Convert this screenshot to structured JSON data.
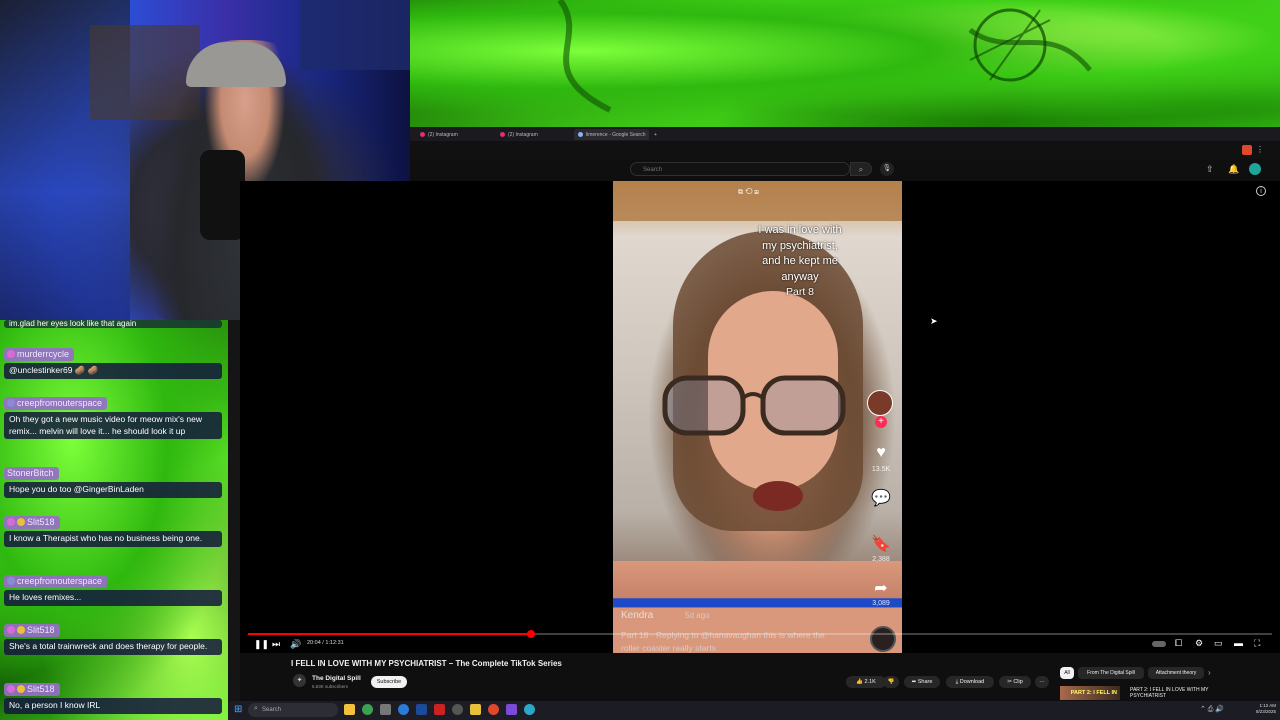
{
  "browser": {
    "tabs": [
      {
        "label": "(2) Instagram",
        "color": "#e1306c"
      },
      {
        "label": "(2) Instagram",
        "color": "#e1306c"
      },
      {
        "label": "limerence - Google Search",
        "color": "#8ab4f8"
      }
    ],
    "new_tab": "+"
  },
  "youtube": {
    "search_placeholder": "Search",
    "search_icon": "search-icon",
    "mic_icon": "mic-icon"
  },
  "video": {
    "caption_lines": [
      "I was in love with",
      "my psychiatrist,",
      "and he kept me",
      "anyway"
    ],
    "caption_part": "Part 8",
    "likes": "13.5K",
    "comments": "",
    "saves": "2,388",
    "shares": "3,089",
    "tiktok_user": "Kendra",
    "tiktok_date": "5d ago",
    "tiktok_desc": "Part 18 · Replying to @hanavaughan this is where the roller coaster really starts.",
    "time": "20:04 / 1:12:31",
    "progress_fraction": 0.276
  },
  "below": {
    "title": "I FELL IN LOVE WITH MY PSYCHIATRIST – The Complete TikTok Series",
    "channel": "The Digital Spill",
    "subs": "6.63K subscribers",
    "subscribe": "Subscribe",
    "likes": "2.1K",
    "share": "Share",
    "download": "Download",
    "clip": "Clip",
    "more": "···",
    "chips": [
      "All",
      "From The Digital Spill",
      "Attachment theory"
    ],
    "rec_title": "PART 2: I FELL IN LOVE WITH MY PSYCHIATRIST",
    "rec_thumb_text": "PART 2: I FELL IN LOVE"
  },
  "taskbar": {
    "search": "Search",
    "time": "1:12 AM",
    "date": "8/23/2025"
  },
  "chat": {
    "top_line": "im.glad her eyes look like that again",
    "messages": [
      {
        "user": "murderrcycle",
        "text": "@unclestinker69 🥔 🥔"
      },
      {
        "user": "creepfromouterspace",
        "text": "Oh they got a new music video for meow mix's new remix... melvin will love it... he should look it up"
      },
      {
        "user": "StonerBitch",
        "text": "Hope you do too @GingerBinLaden"
      },
      {
        "user": "Slit518",
        "text": "I know a Therapist who has no business being one."
      },
      {
        "user": "creepfromouterspace",
        "text": "He loves remixes..."
      },
      {
        "user": "Slit518",
        "text": "She's a total trainwreck and does therapy for people."
      },
      {
        "user": "Slit518",
        "text": "No, a person I know IRL"
      }
    ]
  },
  "colors": {
    "accent": "#ff0000",
    "chat_name_bg": "#9b6ec8",
    "chat_msg_bg": "#14183c",
    "green_bg": "#46d81b"
  }
}
